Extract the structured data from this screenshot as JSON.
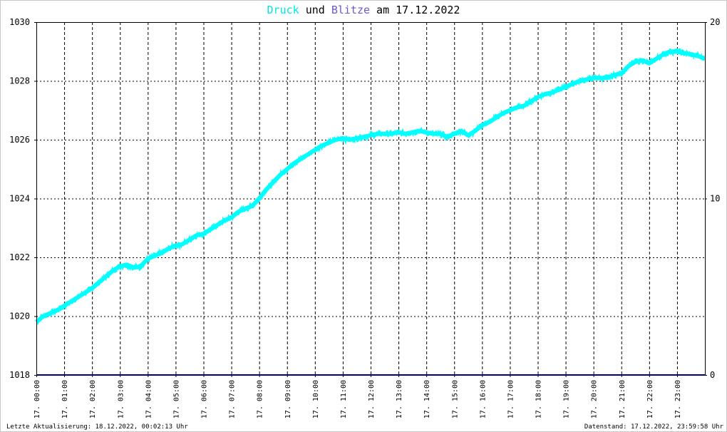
{
  "title": {
    "part1": "Druck",
    "part2": " und ",
    "part3": "Blitze",
    "part4": " am 17.12.2022"
  },
  "footer": {
    "last_update": "Letzte Aktualisierung: 18.12.2022, 00:02:13 Uhr",
    "data_status": "Datenstand: 17.12.2022, 23:59:58 Uhr"
  },
  "colors": {
    "pressure": "#00ffff",
    "lightning": "#000080",
    "grid": "#000000",
    "title_druck": "#00e5e5",
    "title_blitze": "#6a5acd"
  },
  "chart_data": {
    "type": "line",
    "title": "Druck und Blitze am 17.12.2022",
    "xlabel": "",
    "ylabel": "",
    "x_tick_labels": [
      "17. 00:00",
      "17. 01:00",
      "17. 02:00",
      "17. 03:00",
      "17. 04:00",
      "17. 05:00",
      "17. 06:00",
      "17. 07:00",
      "17. 08:00",
      "17. 09:00",
      "17. 10:00",
      "17. 11:00",
      "17. 12:00",
      "17. 13:00",
      "17. 14:00",
      "17. 15:00",
      "17. 16:00",
      "17. 17:00",
      "17. 18:00",
      "17. 19:00",
      "17. 20:00",
      "17. 21:00",
      "17. 22:00",
      "17. 23:00"
    ],
    "x_range_hours": [
      0,
      24
    ],
    "y_left": {
      "range": [
        1018,
        1030
      ],
      "ticks": [
        "1018",
        "1020",
        "1022",
        "1024",
        "1026",
        "1028",
        "1030"
      ]
    },
    "y_right": {
      "range": [
        0,
        20
      ],
      "ticks": [
        "0",
        "10",
        "20"
      ]
    },
    "grid": true,
    "series": [
      {
        "name": "Druck",
        "axis": "left",
        "x_hours": [
          0,
          0.25,
          0.5,
          0.75,
          1,
          1.25,
          1.5,
          1.75,
          2,
          2.25,
          2.5,
          2.75,
          3,
          3.25,
          3.5,
          3.75,
          4,
          4.25,
          4.5,
          4.75,
          5,
          5.25,
          5.5,
          5.75,
          6,
          6.25,
          6.5,
          6.75,
          7,
          7.25,
          7.5,
          7.75,
          8,
          8.25,
          8.5,
          8.75,
          9,
          9.25,
          9.5,
          9.75,
          10,
          10.25,
          10.5,
          10.75,
          11,
          11.25,
          11.5,
          11.75,
          12,
          12.25,
          12.5,
          12.75,
          13,
          13.25,
          13.5,
          13.75,
          14,
          14.25,
          14.5,
          14.75,
          15,
          15.25,
          15.5,
          15.75,
          16,
          16.25,
          16.5,
          16.75,
          17,
          17.25,
          17.5,
          17.75,
          18,
          18.25,
          18.5,
          18.75,
          19,
          19.25,
          19.5,
          19.75,
          20,
          20.25,
          20.5,
          20.75,
          21,
          21.25,
          21.5,
          21.75,
          22,
          22.25,
          22.5,
          22.75,
          23,
          23.25,
          23.5,
          23.75,
          24
        ],
        "values": [
          1019.8,
          1020.0,
          1020.1,
          1020.2,
          1020.35,
          1020.5,
          1020.65,
          1020.8,
          1020.95,
          1021.15,
          1021.35,
          1021.55,
          1021.7,
          1021.75,
          1021.65,
          1021.7,
          1021.95,
          1022.05,
          1022.15,
          1022.3,
          1022.4,
          1022.45,
          1022.6,
          1022.75,
          1022.8,
          1022.95,
          1023.1,
          1023.25,
          1023.35,
          1023.55,
          1023.65,
          1023.75,
          1024.0,
          1024.3,
          1024.55,
          1024.8,
          1025.0,
          1025.2,
          1025.35,
          1025.5,
          1025.65,
          1025.8,
          1025.9,
          1026.0,
          1026.05,
          1026.0,
          1026.05,
          1026.1,
          1026.15,
          1026.2,
          1026.2,
          1026.2,
          1026.25,
          1026.2,
          1026.25,
          1026.3,
          1026.25,
          1026.2,
          1026.2,
          1026.1,
          1026.2,
          1026.3,
          1026.15,
          1026.3,
          1026.5,
          1026.6,
          1026.75,
          1026.9,
          1027.0,
          1027.1,
          1027.15,
          1027.3,
          1027.45,
          1027.55,
          1027.6,
          1027.7,
          1027.8,
          1027.9,
          1028.0,
          1028.05,
          1028.1,
          1028.1,
          1028.1,
          1028.2,
          1028.25,
          1028.5,
          1028.65,
          1028.7,
          1028.6,
          1028.75,
          1028.9,
          1029.0,
          1029.0,
          1028.95,
          1028.9,
          1028.85,
          1028.75
        ]
      },
      {
        "name": "Blitze",
        "axis": "right",
        "x_hours": [
          0,
          24
        ],
        "values": [
          0,
          0
        ]
      }
    ]
  }
}
